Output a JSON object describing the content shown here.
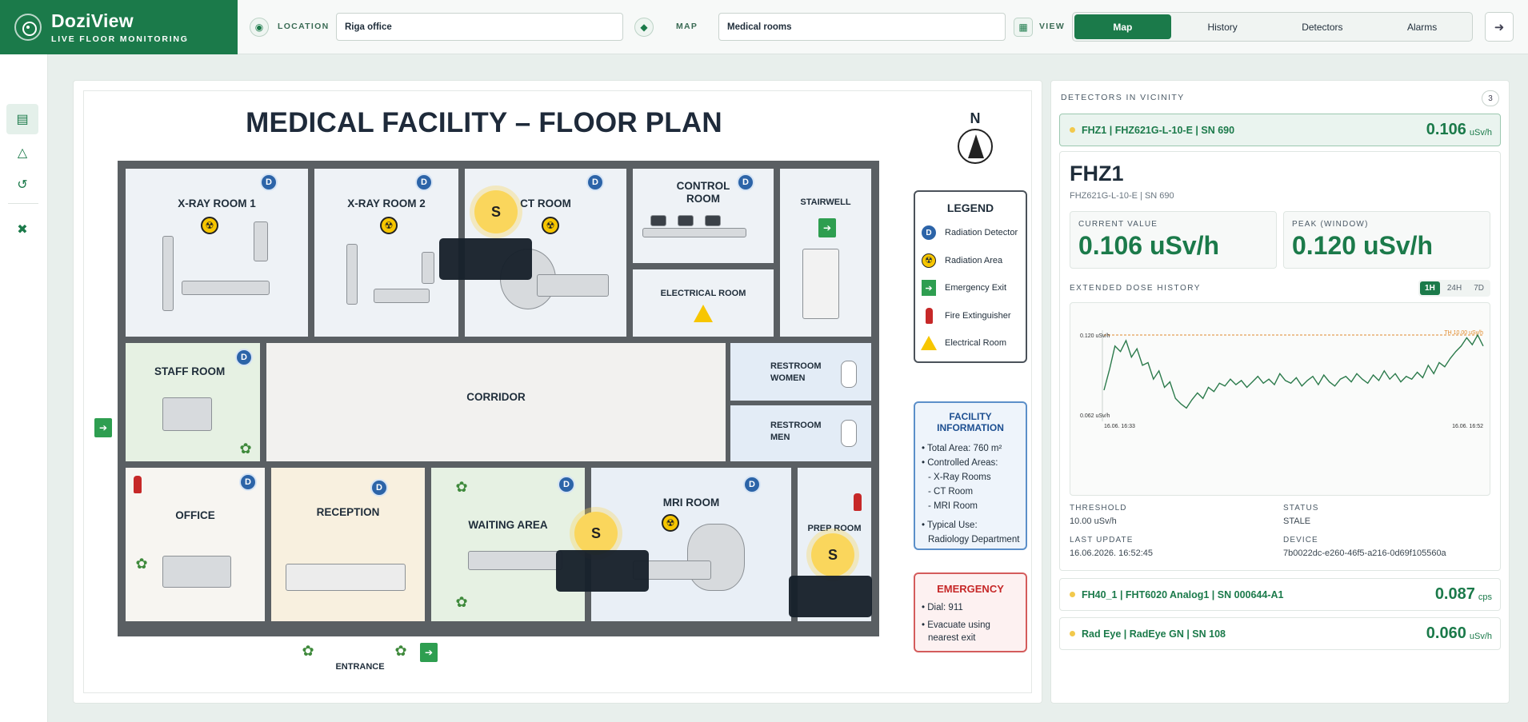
{
  "brand": {
    "title": "DoziView",
    "subtitle": "LIVE FLOOR MONITORING"
  },
  "topbar": {
    "location_label": "LOCATION",
    "location_value": "Riga office",
    "map_label": "MAP",
    "map_value": "Medical rooms",
    "view_label": "VIEW",
    "tabs": [
      "Map",
      "History",
      "Detectors",
      "Alarms"
    ],
    "active_tab": "Map"
  },
  "floorplan": {
    "title": "MEDICAL FACILITY – FLOOR PLAN",
    "north": "N",
    "rooms": {
      "xray1": "X-RAY ROOM 1",
      "xray2": "X-RAY ROOM 2",
      "ct": "CT ROOM",
      "control": "CONTROL\nROOM",
      "stairwell": "STAIRWELL",
      "electrical": "ELECTRICAL ROOM",
      "staff": "STAFF ROOM",
      "corridor": "CORRIDOR",
      "restroom_women": "RESTROOM\nWOMEN",
      "restroom_men": "RESTROOM\nMEN",
      "office": "OFFICE",
      "reception": "RECEPTION",
      "waiting": "WAITING AREA",
      "mri": "MRI ROOM",
      "prep": "PREP ROOM",
      "entrance": "ENTRANCE"
    },
    "detector_marker": "D",
    "sensor_marker": "S",
    "legend": {
      "title": "LEGEND",
      "items": [
        "Radiation Detector",
        "Radiation Area",
        "Emergency Exit",
        "Fire Extinguisher",
        "Electrical Room"
      ]
    },
    "facility_info": {
      "title": "FACILITY INFORMATION",
      "total_area": "• Total Area: 760 m²",
      "controlled": "• Controlled Areas:",
      "areas": [
        "- X-Ray Rooms",
        "- CT Room",
        "- MRI Room"
      ],
      "typical_use": "• Typical Use:",
      "typical_use_value": "Radiology Department"
    },
    "emergency": {
      "title": "EMERGENCY",
      "dial": "• Dial: 911",
      "evacuate": "• Evacuate using",
      "evacuate2": "nearest exit"
    }
  },
  "detectors_panel": {
    "header": "DETECTORS IN VICINITY",
    "count": "3",
    "rows": [
      {
        "name": "FHZ1 | FHZ621G-L-10-E | SN 690",
        "value": "0.106",
        "unit": "uSv/h"
      },
      {
        "name": "FH40_1 | FHT6020 Analog1 | SN 000644-A1",
        "value": "0.087",
        "unit": "cps"
      },
      {
        "name": "Rad Eye | RadEye GN | SN 108",
        "value": "0.060",
        "unit": "uSv/h"
      }
    ],
    "detail": {
      "title": "FHZ1",
      "subtitle": "FHZ621G-L-10-E | SN 690",
      "current_label": "CURRENT VALUE",
      "current_value": "0.106 uSv/h",
      "peak_label": "PEAK (WINDOW)",
      "peak_value": "0.120 uSv/h",
      "history_label": "EXTENDED DOSE HISTORY",
      "ranges": [
        "1H",
        "24H",
        "7D"
      ],
      "active_range": "1H",
      "threshold_label": "THRESHOLD",
      "threshold_value": "10.00 uSv/h",
      "status_label": "STATUS",
      "status_value": "STALE",
      "last_update_label": "LAST UPDATE",
      "last_update_value": "16.06.2026. 16:52:45",
      "device_label": "DEVICE",
      "device_value": "7b0022dc-e260-46f5-a216-0d69f105560a"
    }
  },
  "chart_data": {
    "type": "line",
    "x_start": "16.06. 16:33",
    "x_end": "16.06. 16:52",
    "y_top_label": "0.120 uSv/h",
    "y_bottom_label": "0.062 uSv/h",
    "threshold_label": "TH 10.00 uSv/h",
    "ylim": [
      0.062,
      0.12
    ],
    "values": [
      0.08,
      0.095,
      0.112,
      0.108,
      0.116,
      0.104,
      0.11,
      0.098,
      0.1,
      0.088,
      0.094,
      0.082,
      0.086,
      0.074,
      0.07,
      0.067,
      0.073,
      0.078,
      0.074,
      0.082,
      0.079,
      0.085,
      0.083,
      0.088,
      0.084,
      0.087,
      0.082,
      0.086,
      0.09,
      0.085,
      0.088,
      0.084,
      0.092,
      0.087,
      0.085,
      0.089,
      0.083,
      0.087,
      0.09,
      0.084,
      0.091,
      0.086,
      0.083,
      0.088,
      0.09,
      0.086,
      0.092,
      0.088,
      0.085,
      0.091,
      0.087,
      0.094,
      0.088,
      0.092,
      0.086,
      0.09,
      0.088,
      0.093,
      0.089,
      0.098,
      0.092,
      0.1,
      0.097,
      0.103,
      0.108,
      0.112,
      0.118,
      0.113,
      0.12,
      0.112
    ]
  }
}
